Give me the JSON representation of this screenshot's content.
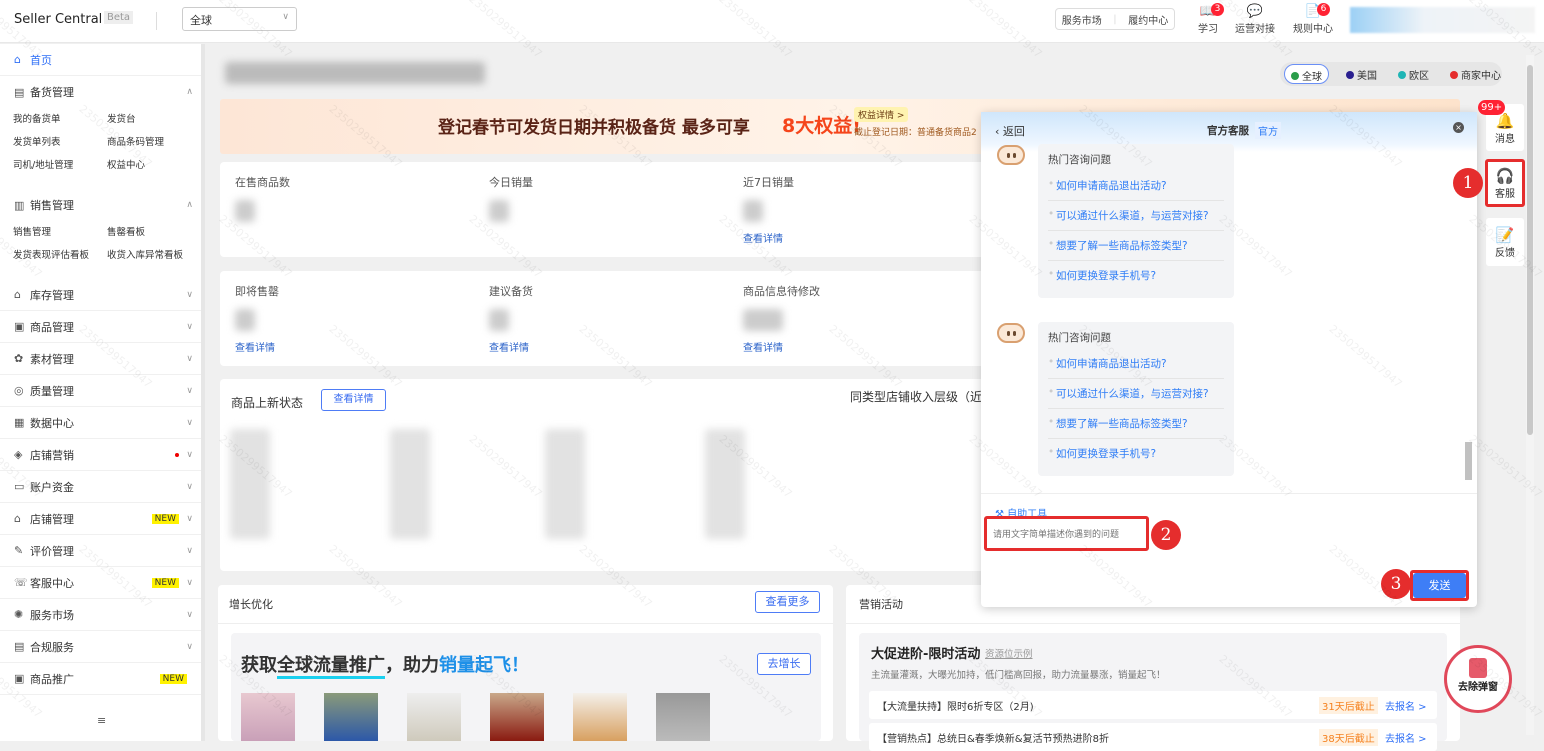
{
  "header": {
    "brand": "Seller Central",
    "beta": "Beta",
    "region_select": "全球",
    "service_market": "服务市场",
    "fulfillment_center": "履约中心",
    "icons": [
      {
        "label": "学习",
        "badge": "3",
        "icon": "book-icon"
      },
      {
        "label": "运营对接",
        "badge": "",
        "icon": "chat-icon"
      },
      {
        "label": "规则中心",
        "badge": "6",
        "icon": "document-icon"
      }
    ]
  },
  "sidebar": {
    "items": [
      {
        "label": "首页",
        "icon": "home-icon",
        "active": true
      },
      {
        "label": "备货管理",
        "icon": "clipboard-icon",
        "expanded": true,
        "sub": [
          "我的备货单",
          "发货台",
          "发货单列表",
          "商品条码管理",
          "司机/地址管理",
          "权益中心"
        ]
      },
      {
        "label": "销售管理",
        "icon": "chart-icon",
        "expanded": true,
        "sub": [
          "销售管理",
          "售罄看板",
          "发货表现评估看板",
          "收货入库异常看板"
        ]
      },
      {
        "label": "库存管理",
        "icon": "warehouse-icon"
      },
      {
        "label": "商品管理",
        "icon": "box-icon"
      },
      {
        "label": "素材管理",
        "icon": "material-icon"
      },
      {
        "label": "质量管理",
        "icon": "shield-icon"
      },
      {
        "label": "数据中心",
        "icon": "data-icon"
      },
      {
        "label": "店铺营销",
        "icon": "tag-icon",
        "dot": true
      },
      {
        "label": "账户资金",
        "icon": "wallet-icon"
      },
      {
        "label": "店铺管理",
        "icon": "store-icon",
        "badge": "NEW"
      },
      {
        "label": "评价管理",
        "icon": "review-icon"
      },
      {
        "label": "客服中心",
        "icon": "support-icon",
        "badge": "NEW"
      },
      {
        "label": "服务市场",
        "icon": "market-icon"
      },
      {
        "label": "合规服务",
        "icon": "compliance-icon"
      },
      {
        "label": "商品推广",
        "icon": "promo-icon",
        "badge": "NEW"
      }
    ]
  },
  "regions": [
    {
      "label": "全球",
      "color": "#2a9d4a",
      "active": true
    },
    {
      "label": "美国",
      "color": "#2a1f8f"
    },
    {
      "label": "欧区",
      "color": "#1fb5b5"
    },
    {
      "label": "商家中心",
      "color": "#e52d2d"
    }
  ],
  "banner": {
    "text": "登记春节可发货日期并积极备货 最多可享",
    "highlight": "8大权益!",
    "detail_btn": "权益详情 >",
    "sub": "截止登记日期：普通备货商品2"
  },
  "stats1": [
    {
      "label": "在售商品数"
    },
    {
      "label": "今日销量"
    },
    {
      "label": "近7日销量",
      "link": "查看详情"
    }
  ],
  "stats2": [
    {
      "label": "即将售罄",
      "link": "查看详情"
    },
    {
      "label": "建议备货",
      "link": "查看详情"
    },
    {
      "label": "商品信息待修改",
      "link": "查看详情"
    }
  ],
  "listing": {
    "title": "商品上新状态",
    "btn": "查看详情",
    "right_title": "同类型店铺收入层级（近"
  },
  "growth": {
    "title": "增长优化",
    "more": "查看更多",
    "headline_a": "获取",
    "headline_b": "全球流量推广",
    "headline_c": "，助力",
    "headline_d": "销量起飞！",
    "btn": "去增长"
  },
  "marketing": {
    "title": "营销活动",
    "promo_title": "大促进阶-限时活动",
    "promo_tag": "资源位示例",
    "promo_desc": "主流量灌溉，大曝光加持，低门槛高回报，助力流量暴涨，销量起飞！",
    "rows": [
      {
        "name": "【大流量扶持】限时6折专区（2月)",
        "deadline": "31天后截止",
        "action": "去报名 >"
      },
      {
        "name": "【营销热点】总统日&春季焕新&复活节预热进阶8折",
        "deadline": "38天后截止",
        "action": "去报名 >"
      }
    ]
  },
  "chat": {
    "back": "返回",
    "title": "官方客服",
    "official_tag": "官方",
    "faq_title": "热门咨询问题",
    "faqs": [
      "如何申请商品退出活动?",
      "可以通过什么渠道，与运营对接?",
      "想要了解一些商品标签类型?",
      "如何更换登录手机号?"
    ],
    "self_service": "自助工具",
    "input_placeholder": "请用文字简单描述你遇到的问题",
    "send": "发送"
  },
  "rail": {
    "messages": "消息",
    "messages_badge": "99+",
    "support": "客服",
    "feedback": "反馈",
    "remove_popup": "去除弹窗"
  },
  "annotations": [
    "1",
    "2",
    "3"
  ],
  "watermark": "2350299517947"
}
